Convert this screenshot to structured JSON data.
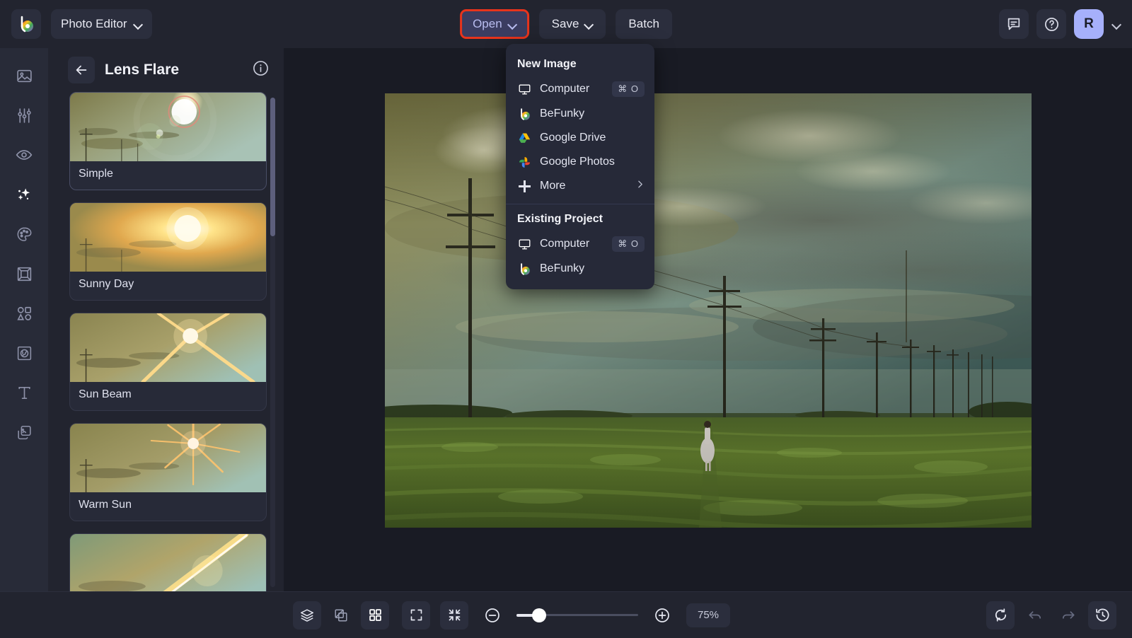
{
  "header": {
    "logo_name": "befunky-logo",
    "app_switcher_label": "Photo Editor",
    "buttons": [
      {
        "label": "Open",
        "icon": "chevron-down-icon",
        "highlighted": true
      },
      {
        "label": "Save",
        "icon": "chevron-down-icon",
        "highlighted": false
      },
      {
        "label": "Batch",
        "icon": null,
        "highlighted": false
      }
    ],
    "feedback_icon": "chat-bubble-icon",
    "help_icon": "question-mark-circle-icon",
    "avatar_initial": "R",
    "avatar_color": "#a6b0fb",
    "open_highlight_color": "#e8341c"
  },
  "rail": {
    "items": [
      {
        "name": "image-manager",
        "icon": "image-icon",
        "active": false
      },
      {
        "name": "edit-adjust",
        "icon": "sliders-icon",
        "active": false
      },
      {
        "name": "touch-up",
        "icon": "eye-icon",
        "active": false
      },
      {
        "name": "effects",
        "icon": "sparkles-icon",
        "active": true
      },
      {
        "name": "artsy",
        "icon": "palette-icon",
        "active": false
      },
      {
        "name": "frames",
        "icon": "frame-icon",
        "active": false
      },
      {
        "name": "graphics",
        "icon": "shapes-icon",
        "active": false
      },
      {
        "name": "textures",
        "icon": "texture-icon",
        "active": false
      },
      {
        "name": "text",
        "icon": "text-icon",
        "active": false
      },
      {
        "name": "layers",
        "icon": "layers-stack-icon",
        "active": false
      }
    ]
  },
  "panel": {
    "back_icon": "arrow-left-icon",
    "title": "Lens Flare",
    "info_icon": "info-circle-icon",
    "presets": [
      {
        "label": "Simple",
        "selected": true
      },
      {
        "label": "Sunny Day",
        "selected": false
      },
      {
        "label": "Sun Beam",
        "selected": false
      },
      {
        "label": "Warm Sun",
        "selected": false
      },
      {
        "label": "",
        "selected": false
      }
    ]
  },
  "dropdown": {
    "visible": true,
    "sections": [
      {
        "title": "New Image",
        "items": [
          {
            "label": "Computer",
            "icon": "computer-monitor-icon",
            "shortcut": "⌘ O",
            "arrow": false
          },
          {
            "label": "BeFunky",
            "icon": "befunky-logo-icon",
            "shortcut": "",
            "arrow": false
          },
          {
            "label": "Google Drive",
            "icon": "google-drive-icon",
            "shortcut": "",
            "arrow": false
          },
          {
            "label": "Google Photos",
            "icon": "google-photos-icon",
            "shortcut": "",
            "arrow": false
          },
          {
            "label": "More",
            "icon": "plus-icon",
            "shortcut": "",
            "arrow": true
          }
        ]
      },
      {
        "title": "Existing Project",
        "items": [
          {
            "label": "Computer",
            "icon": "computer-monitor-icon",
            "shortcut": "⌘ O",
            "arrow": false
          },
          {
            "label": "BeFunky",
            "icon": "befunky-logo-icon",
            "shortcut": "",
            "arrow": false
          }
        ]
      }
    ]
  },
  "canvas": {
    "image_description": "green soybean field under dramatic storm clouds with power lines and a person walking"
  },
  "bottom_bar": {
    "left_tools": [
      {
        "name": "layers-button",
        "icon": "layers-stack-icon",
        "state": "filled"
      },
      {
        "name": "compare-button",
        "icon": "compare-split-icon",
        "state": "plain"
      },
      {
        "name": "grid-button",
        "icon": "grid-four-icon",
        "state": "on"
      }
    ],
    "view_tools": [
      {
        "name": "fit-screen-button",
        "icon": "expand-corners-icon"
      },
      {
        "name": "actual-size-button",
        "icon": "collapse-corners-icon"
      }
    ],
    "zoom_out_icon": "minus-circle-icon",
    "zoom_in_icon": "plus-circle-icon",
    "zoom_value": "75%",
    "zoom_percent": 75,
    "right_tools": [
      {
        "name": "reset-button",
        "icon": "refresh-reset-icon",
        "state": "filled"
      },
      {
        "name": "undo-button",
        "icon": "undo-arrow-icon",
        "state": "dim"
      },
      {
        "name": "redo-button",
        "icon": "redo-arrow-icon",
        "state": "dim"
      },
      {
        "name": "history-button",
        "icon": "clock-history-icon",
        "state": "filled"
      }
    ]
  }
}
